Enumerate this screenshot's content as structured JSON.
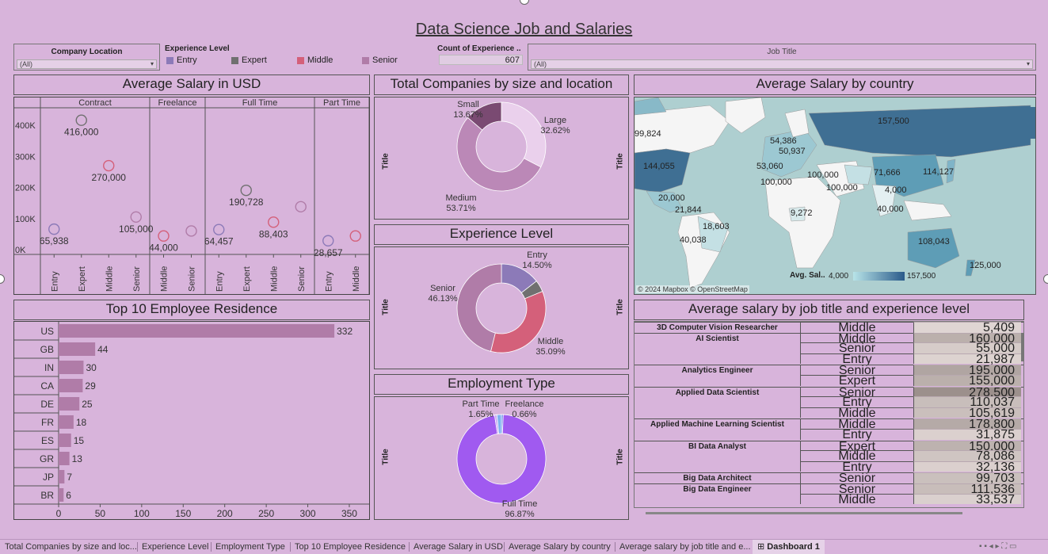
{
  "dashboard_title": "Data Science Job and Salaries",
  "filters": {
    "company_location": {
      "label": "Company Location",
      "value": "(All)"
    },
    "experience_level": {
      "label": "Experience Level",
      "items": [
        {
          "label": "Entry",
          "color": "#8c7ab8"
        },
        {
          "label": "Expert",
          "color": "#707070"
        },
        {
          "label": "Middle",
          "color": "#d4607a"
        },
        {
          "label": "Senior",
          "color": "#b07ca8"
        }
      ]
    },
    "count_experience": {
      "label": "Count of Experience ..",
      "value": "607"
    },
    "job_title": {
      "label": "Job Title",
      "value": "(All)"
    }
  },
  "panels": {
    "avg_salary_usd": "Average Salary in USD",
    "companies": "Total Companies by size and location",
    "country": "Average Salary by country",
    "experience": "Experience Level",
    "employment": "Employment Type",
    "residence": "Top 10 Employee Residence",
    "job_title_table": "Average salary by job title and experience level"
  },
  "side_label": "Title",
  "chart_data": [
    {
      "type": "scatter",
      "title": "Average Salary in USD",
      "groups": [
        "Contract",
        "Freelance",
        "Full Time",
        "Part Time"
      ],
      "y_ticks": [
        "400K",
        "300K",
        "200K",
        "100K",
        "0K"
      ],
      "ylim": [
        0,
        450000
      ],
      "points": [
        {
          "group": "Contract",
          "level": "Entry",
          "value": 65938,
          "label": "65,938",
          "color": "#8c7ab8"
        },
        {
          "group": "Contract",
          "level": "Expert",
          "value": 416000,
          "label": "416,000",
          "color": "#707070"
        },
        {
          "group": "Contract",
          "level": "Middle",
          "value": 270000,
          "label": "270,000",
          "color": "#d4607a"
        },
        {
          "group": "Contract",
          "level": "Senior",
          "value": 105000,
          "label": "105,000",
          "color": "#b07ca8"
        },
        {
          "group": "Freelance",
          "level": "Middle",
          "value": 44000,
          "label": "44,000",
          "color": "#d4607a"
        },
        {
          "group": "Freelance",
          "level": "Senior",
          "value": 60000,
          "label": "",
          "color": "#b07ca8"
        },
        {
          "group": "Full Time",
          "level": "Entry",
          "value": 64457,
          "label": "64,457",
          "color": "#8c7ab8"
        },
        {
          "group": "Full Time",
          "level": "Expert",
          "value": 190728,
          "label": "190,728",
          "color": "#707070"
        },
        {
          "group": "Full Time",
          "level": "Middle",
          "value": 88403,
          "label": "88,403",
          "color": "#d4607a"
        },
        {
          "group": "Full Time",
          "level": "Senior",
          "value": 138000,
          "label": "",
          "color": "#b07ca8"
        },
        {
          "group": "Part Time",
          "level": "Entry",
          "value": 28657,
          "label": "28,657",
          "color": "#8c7ab8"
        },
        {
          "group": "Part Time",
          "level": "Middle",
          "value": 44000,
          "label": "",
          "color": "#d4607a"
        }
      ],
      "x_labels": [
        {
          "group": "Contract",
          "levels": [
            "Entry",
            "Expert",
            "Middle",
            "Senior"
          ]
        },
        {
          "group": "Freelance",
          "levels": [
            "Middle",
            "Senior"
          ]
        },
        {
          "group": "Full Time",
          "levels": [
            "Entry",
            "Expert",
            "Middle",
            "Senior"
          ]
        },
        {
          "group": "Part Time",
          "levels": [
            "Entry",
            "Middle"
          ]
        }
      ]
    },
    {
      "type": "pie",
      "title": "Total Companies by size and location",
      "slices": [
        {
          "label": "Large",
          "value": 32.62,
          "text": "32.62%",
          "color": "#ead0ec"
        },
        {
          "label": "Medium",
          "value": 53.71,
          "text": "53.71%",
          "color": "#bb88b7"
        },
        {
          "label": "Small",
          "value": 13.67,
          "text": "13.67%",
          "color": "#7a4a72"
        }
      ]
    },
    {
      "type": "pie",
      "title": "Experience Level",
      "slices": [
        {
          "label": "Entry",
          "value": 14.5,
          "text": "14.50%",
          "color": "#8c7ab8"
        },
        {
          "label": "Expert",
          "value": 4.28,
          "text": "",
          "color": "#707070"
        },
        {
          "label": "Middle",
          "value": 35.09,
          "text": "35.09%",
          "color": "#d4607a"
        },
        {
          "label": "Senior",
          "value": 46.13,
          "text": "46.13%",
          "color": "#b07ca8"
        }
      ]
    },
    {
      "type": "pie",
      "title": "Employment Type",
      "slices": [
        {
          "label": "Freelance",
          "value": 0.66,
          "text": "0.66%",
          "color": "#5e7ee6"
        },
        {
          "label": "Full Time",
          "value": 96.87,
          "text": "96.87%",
          "color": "#a05af0"
        },
        {
          "label": "Contract",
          "value": 0.82,
          "text": "",
          "color": "#c6a2f2"
        },
        {
          "label": "Part Time",
          "value": 1.65,
          "text": "1.65%",
          "color": "#7fb2f0"
        }
      ]
    },
    {
      "type": "bar",
      "title": "Top 10 Employee Residence",
      "categories": [
        "US",
        "GB",
        "IN",
        "CA",
        "DE",
        "FR",
        "ES",
        "GR",
        "JP",
        "BR"
      ],
      "values": [
        332,
        44,
        30,
        29,
        25,
        18,
        15,
        13,
        7,
        6
      ],
      "x_ticks": [
        "0",
        "50",
        "100",
        "150",
        "200",
        "250",
        "300",
        "350"
      ],
      "xlim": [
        0,
        350
      ]
    }
  ],
  "map": {
    "title": "Average Salary by country",
    "labels": [
      "157,500",
      "99,824",
      "54,386",
      "50,937",
      "144,055",
      "53,060",
      "100,000",
      "100,000",
      "100,000",
      "71,666",
      "114,127",
      "4,000",
      "40,000",
      "20,000",
      "21,844",
      "9,272",
      "18,603",
      "40,038",
      "108,043",
      "125,000"
    ],
    "legend_title": "Avg. Sal..",
    "legend_min": "4,000",
    "legend_max": "157,500",
    "copyright": "© 2024 Mapbox © OpenStreetMap"
  },
  "job_table": {
    "rows": [
      {
        "title": "3D Computer Vision Researcher",
        "level": "Middle",
        "value": "5,409",
        "shade": 0.02
      },
      {
        "title": "AI Scientist",
        "level": "Middle",
        "value": "160,000",
        "shade": 0.55
      },
      {
        "title": "",
        "level": "Senior",
        "value": "55,000",
        "shade": 0.15
      },
      {
        "title": "",
        "level": "Entry",
        "value": "21,987",
        "shade": 0.05
      },
      {
        "title": "Analytics Engineer",
        "level": "Senior",
        "value": "195,000",
        "shade": 0.7
      },
      {
        "title": "",
        "level": "Expert",
        "value": "155,000",
        "shade": 0.55
      },
      {
        "title": "Applied Data Scientist",
        "level": "Senior",
        "value": "278,500",
        "shade": 1.0
      },
      {
        "title": "",
        "level": "Entry",
        "value": "110,037",
        "shade": 0.35
      },
      {
        "title": "",
        "level": "Middle",
        "value": "105,619",
        "shade": 0.33
      },
      {
        "title": "Applied Machine Learning Scientist",
        "level": "Middle",
        "value": "178,800",
        "shade": 0.63
      },
      {
        "title": "",
        "level": "Entry",
        "value": "31,875",
        "shade": 0.08
      },
      {
        "title": "BI Data Analyst",
        "level": "Expert",
        "value": "150,000",
        "shade": 0.52
      },
      {
        "title": "",
        "level": "Middle",
        "value": "78,086",
        "shade": 0.25
      },
      {
        "title": "",
        "level": "Entry",
        "value": "32,136",
        "shade": 0.08
      },
      {
        "title": "Big Data Architect",
        "level": "Senior",
        "value": "99,703",
        "shade": 0.32
      },
      {
        "title": "Big Data Engineer",
        "level": "Senior",
        "value": "111,536",
        "shade": 0.36
      },
      {
        "title": "",
        "level": "Middle",
        "value": "33,537",
        "shade": 0.09
      }
    ]
  },
  "tabs": [
    "Total Companies by size and loc...",
    "Experience Level",
    "Employment Type",
    "Top 10 Employee Residence",
    "Average Salary in USD",
    "Average Salary by country",
    "Average salary by job title and e...",
    "Dashboard 1"
  ]
}
